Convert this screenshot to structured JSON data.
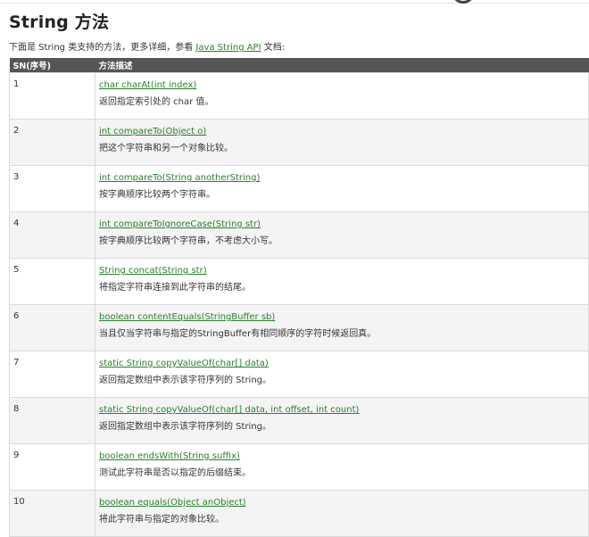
{
  "page": {
    "title": "String 方法",
    "intro_prefix": "下面是 String 类支持的方法，更多详细，参看 ",
    "intro_link": "Java String API",
    "intro_suffix": " 文档:"
  },
  "table": {
    "headers": [
      "SN(序号)",
      "方法描述"
    ],
    "rows": [
      {
        "sn": "1",
        "signature": "char charAt(int index)",
        "description": "返回指定索引处的 char 值。"
      },
      {
        "sn": "2",
        "signature": "int compareTo(Object o)",
        "description": "把这个字符串和另一个对象比较。"
      },
      {
        "sn": "3",
        "signature": "int compareTo(String anotherString)",
        "description": "按字典顺序比较两个字符串。"
      },
      {
        "sn": "4",
        "signature": "int compareToIgnoreCase(String str)",
        "description": "按字典顺序比较两个字符串，不考虑大小写。"
      },
      {
        "sn": "5",
        "signature": "String concat(String str)",
        "description": "将指定字符串连接到此字符串的结尾。"
      },
      {
        "sn": "6",
        "signature": "boolean contentEquals(StringBuffer sb)",
        "description": "当且仅当字符串与指定的StringBuffer有相同顺序的字符时候返回真。"
      },
      {
        "sn": "7",
        "signature": "static String copyValueOf(char[] data)",
        "description": "返回指定数组中表示该字符序列的 String。"
      },
      {
        "sn": "8",
        "signature": "static String copyValueOf(char[] data, int offset, int count)",
        "description": "返回指定数组中表示该字符序列的 String。"
      },
      {
        "sn": "9",
        "signature": "boolean endsWith(String suffix)",
        "description": "测试此字符串是否以指定的后缀结束。"
      },
      {
        "sn": "10",
        "signature": "boolean equals(Object anObject)",
        "description": "将此字符串与指定的对象比较。"
      }
    ]
  }
}
